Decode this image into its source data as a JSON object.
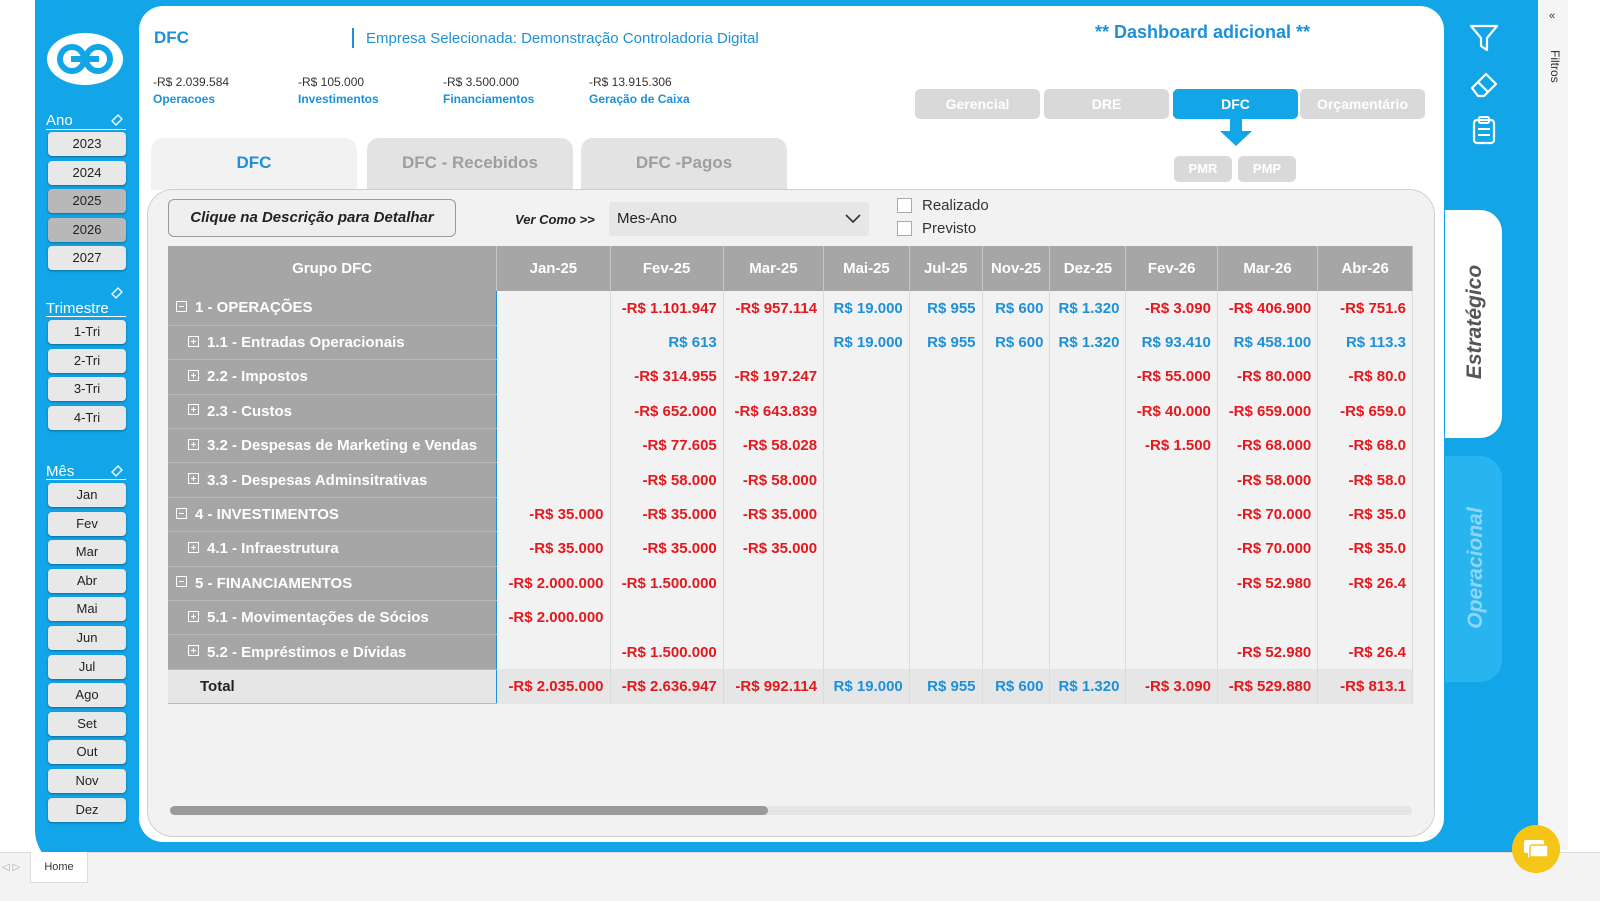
{
  "header": {
    "page_title": "DFC",
    "empresa": "Empresa Selecionada: Demonstração Controladoria Digital",
    "dashboard_extra": "** Dashboard adicional **"
  },
  "kpis": [
    {
      "value": "-R$ 2.039.584",
      "label": "Operacoes"
    },
    {
      "value": "-R$ 105.000",
      "label": "Investimentos"
    },
    {
      "value": "-R$ 3.500.000",
      "label": "Financiamentos"
    },
    {
      "value": "-R$ 13.915.306",
      "label": "Geração de Caixa"
    }
  ],
  "nav": {
    "items": [
      "Gerencial",
      "DRE",
      "DFC",
      "Orçamentário"
    ],
    "active": "DFC",
    "sub_items": [
      "PMR",
      "PMP"
    ]
  },
  "tabs": {
    "items": [
      "DFC",
      "DFC - Recebidos",
      "DFC -Pagos"
    ],
    "active": "DFC"
  },
  "slicers": {
    "ano": {
      "title": "Ano",
      "items": [
        "2023",
        "2024",
        "2025",
        "2026",
        "2027"
      ],
      "selected": [
        "2025",
        "2026"
      ]
    },
    "trimestre": {
      "title": "Trimestre",
      "items": [
        "1-Tri",
        "2-Tri",
        "3-Tri",
        "4-Tri"
      ]
    },
    "mes": {
      "title": "Mês",
      "items": [
        "Jan",
        "Fev",
        "Mar",
        "Abr",
        "Mai",
        "Jun",
        "Jul",
        "Ago",
        "Set",
        "Out",
        "Nov",
        "Dez"
      ]
    }
  },
  "controls": {
    "hint_button": "Clique na Descrição para Detalhar",
    "ver_como_label": "Ver Como >>",
    "ver_como_value": "Mes-Ano",
    "checkbox_realizado": "Realizado",
    "checkbox_previsto": "Previsto"
  },
  "matrix": {
    "group_header": "Grupo DFC",
    "columns": [
      "Jan-25",
      "Fev-25",
      "Mar-25",
      "Mai-25",
      "Jul-25",
      "Nov-25",
      "Dez-25",
      "Fev-26",
      "Mar-26",
      "Abr-26"
    ],
    "rows": [
      {
        "label": "1 - OPERAÇÕES",
        "level": 0,
        "cells": [
          "",
          "-R$ 1.101.947",
          "-R$ 957.114",
          "R$ 19.000",
          "R$ 955",
          "R$ 600",
          "R$ 1.320",
          "-R$ 3.090",
          "-R$ 406.900",
          "-R$ 751.6"
        ]
      },
      {
        "label": "1.1 - Entradas Operacionais",
        "level": 1,
        "cells": [
          "",
          "R$ 613",
          "",
          "R$ 19.000",
          "R$ 955",
          "R$ 600",
          "R$ 1.320",
          "R$ 93.410",
          "R$ 458.100",
          "R$ 113.3"
        ]
      },
      {
        "label": "2.2 - Impostos",
        "level": 1,
        "cells": [
          "",
          "-R$ 314.955",
          "-R$ 197.247",
          "",
          "",
          "",
          "",
          "-R$ 55.000",
          "-R$ 80.000",
          "-R$ 80.0"
        ]
      },
      {
        "label": "2.3 - Custos",
        "level": 1,
        "cells": [
          "",
          "-R$ 652.000",
          "-R$ 643.839",
          "",
          "",
          "",
          "",
          "-R$ 40.000",
          "-R$ 659.000",
          "-R$ 659.0"
        ]
      },
      {
        "label": "3.2 - Despesas de Marketing e Vendas",
        "level": 1,
        "cells": [
          "",
          "-R$ 77.605",
          "-R$ 58.028",
          "",
          "",
          "",
          "",
          "-R$ 1.500",
          "-R$ 68.000",
          "-R$ 68.0"
        ]
      },
      {
        "label": "3.3 - Despesas Adminsitrativas",
        "level": 1,
        "cells": [
          "",
          "-R$ 58.000",
          "-R$ 58.000",
          "",
          "",
          "",
          "",
          "",
          "-R$ 58.000",
          "-R$ 58.0"
        ]
      },
      {
        "label": "4 - INVESTIMENTOS",
        "level": 0,
        "cells": [
          "-R$ 35.000",
          "-R$ 35.000",
          "-R$ 35.000",
          "",
          "",
          "",
          "",
          "",
          "-R$ 70.000",
          "-R$ 35.0"
        ]
      },
      {
        "label": "4.1 - Infraestrutura",
        "level": 1,
        "cells": [
          "-R$ 35.000",
          "-R$ 35.000",
          "-R$ 35.000",
          "",
          "",
          "",
          "",
          "",
          "-R$ 70.000",
          "-R$ 35.0"
        ]
      },
      {
        "label": "5 - FINANCIAMENTOS",
        "level": 0,
        "cells": [
          "-R$ 2.000.000",
          "-R$ 1.500.000",
          "",
          "",
          "",
          "",
          "",
          "",
          "-R$ 52.980",
          "-R$ 26.4"
        ]
      },
      {
        "label": "5.1 - Movimentações de Sócios",
        "level": 1,
        "cells": [
          "-R$ 2.000.000",
          "",
          "",
          "",
          "",
          "",
          "",
          "",
          "",
          ""
        ]
      },
      {
        "label": "5.2 - Empréstimos e Dívidas",
        "level": 1,
        "cells": [
          "",
          "-R$ 1.500.000",
          "",
          "",
          "",
          "",
          "",
          "",
          "-R$ 52.980",
          "-R$ 26.4"
        ]
      }
    ],
    "total": {
      "label": "Total",
      "cells": [
        "-R$ 2.035.000",
        "-R$ 2.636.947",
        "-R$ 992.114",
        "R$ 19.000",
        "R$ 955",
        "R$ 600",
        "R$ 1.320",
        "-R$ 3.090",
        "-R$ 529.880",
        "-R$ 813.1"
      ]
    }
  },
  "side_tabs": {
    "estrategico": "Estratégico",
    "operacional": "Operacional"
  },
  "right_panel": {
    "filtros_label": "Filtros",
    "collapse_glyph": "«"
  },
  "bottom": {
    "page_tab": "Home",
    "nav_arrows": "◁ ▷"
  },
  "colors": {
    "brand_blue": "#12a5e8",
    "text_blue": "#1e90d8",
    "negative_red": "#e3191e",
    "header_gray": "#a6a6a6"
  },
  "icons": [
    "filter-icon",
    "eraser-icon",
    "clipboard-icon",
    "chat-icon",
    "logo-icon"
  ]
}
